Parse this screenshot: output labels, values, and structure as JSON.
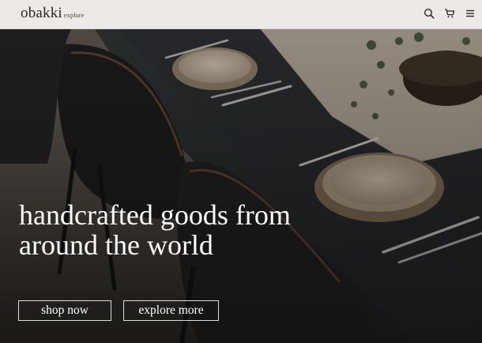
{
  "header": {
    "brand_name": "obakki",
    "brand_sub": "explore",
    "icons": [
      "search-icon",
      "cart-icon",
      "menu-icon"
    ]
  },
  "hero": {
    "headline_line1": "handcrafted goods from",
    "headline_line2": "around the world",
    "primary_button": "shop now",
    "secondary_button": "explore more"
  },
  "colors": {
    "header_bg": "#ece9e6",
    "brand_text": "#2a2725",
    "hero_text": "#ffffff"
  }
}
